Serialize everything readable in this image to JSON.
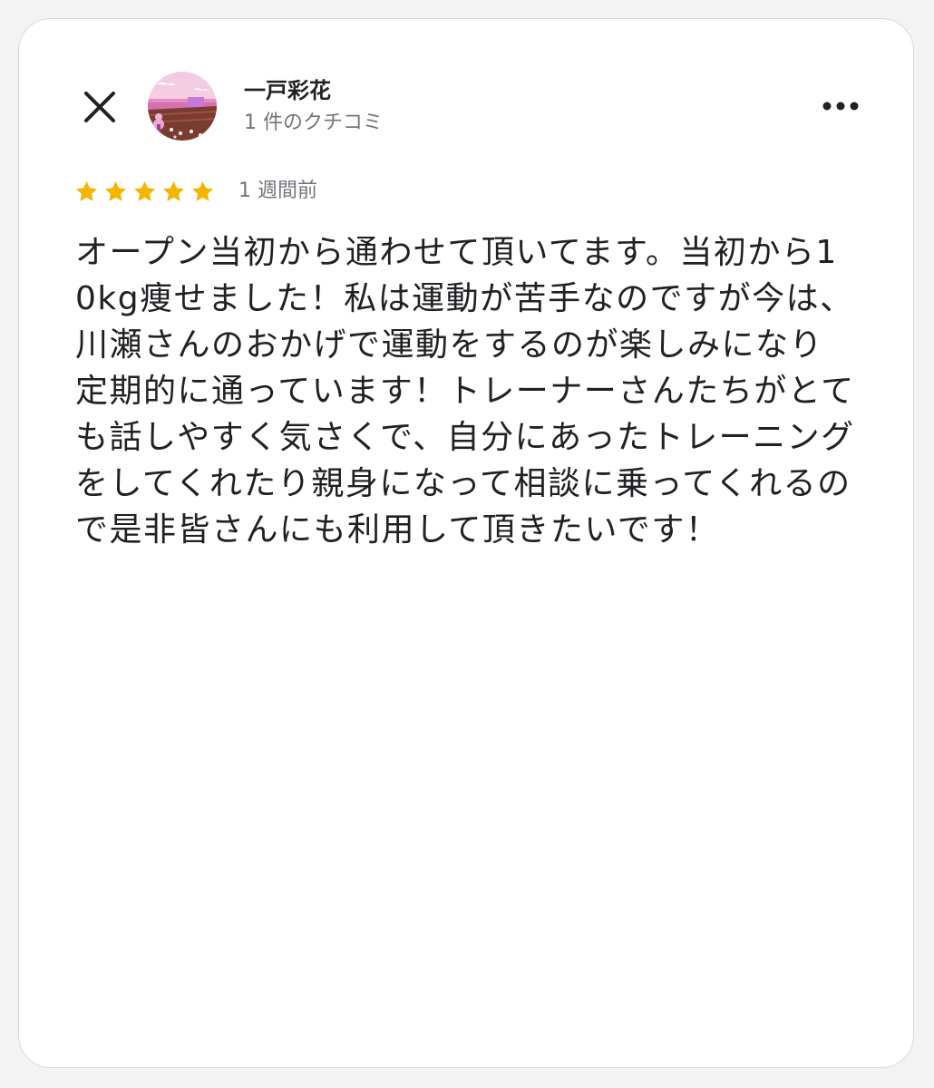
{
  "reviewer": {
    "name": "一戸彩花",
    "review_count": "1 件のクチコミ"
  },
  "review": {
    "rating": 5,
    "max_rating": 5,
    "time": "1 週間前",
    "text": "オープン当初から通わせて頂いてます。当初から10kg痩せました！私は運動が苦手なのですが今は、川瀬さんのおかげで運動をするのが楽しみになり定期的に通っています！トレーナーさんたちがとても話しやすく気さくで、自分にあったトレーニングをしてくれたり親身になって相談に乗ってくれるので是非皆さんにも利用して頂きたいです！"
  },
  "icons": {
    "close": "close-icon",
    "more": "more-horizontal-icon",
    "star": "star-icon"
  },
  "colors": {
    "star": "#f4b400",
    "text_primary": "#202124",
    "text_secondary": "#70757a"
  }
}
